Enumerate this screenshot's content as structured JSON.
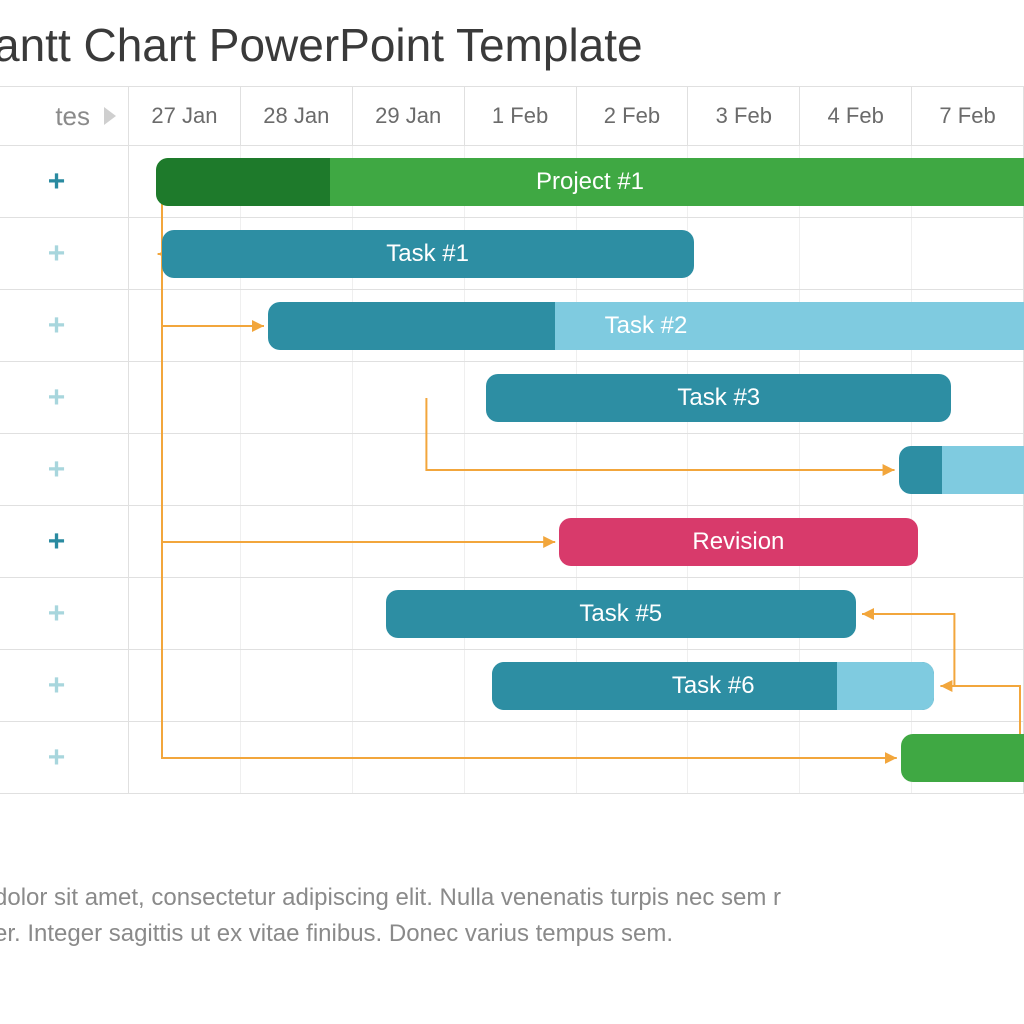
{
  "title": "antt Chart PowerPoint Template",
  "left_header": "tes",
  "dates": [
    "27 Jan",
    "28 Jan",
    "29 Jan",
    "1 Feb",
    "2 Feb",
    "3 Feb",
    "4 Feb",
    "7 Feb"
  ],
  "rows": [
    {
      "plus": "active"
    },
    {
      "plus": "muted"
    },
    {
      "plus": "muted"
    },
    {
      "plus": "muted"
    },
    {
      "plus": "muted"
    },
    {
      "plus": "active"
    },
    {
      "plus": "muted"
    },
    {
      "plus": "muted"
    },
    {
      "plus": "muted"
    }
  ],
  "bars": [
    {
      "name": "Project #1",
      "row": 0,
      "start": 0.25,
      "end": 8.0,
      "color": "#3fa843",
      "prog": 0.2,
      "progColor": "#1e7a2b",
      "roundRight": false
    },
    {
      "name": "Task #1",
      "row": 1,
      "start": 0.3,
      "end": 5.05,
      "color": "#2d8ea3"
    },
    {
      "name": "Task #2",
      "row": 2,
      "start": 1.25,
      "end": 8.0,
      "color": "#7fcbe0",
      "prog": 0.38,
      "progColor": "#2d8ea3",
      "roundRight": false
    },
    {
      "name": "Task #3",
      "row": 3,
      "start": 3.2,
      "end": 7.35,
      "color": "#2d8ea3"
    },
    {
      "name": "",
      "row": 4,
      "start": 6.88,
      "end": 8.0,
      "color": "#7fcbe0",
      "prog": 0.35,
      "progColor": "#2d8ea3",
      "roundRight": false
    },
    {
      "name": "Revision",
      "row": 5,
      "start": 3.85,
      "end": 7.05,
      "color": "#d83a6b"
    },
    {
      "name": "Task #5",
      "row": 6,
      "start": 2.3,
      "end": 6.5,
      "color": "#2d8ea3"
    },
    {
      "name": "Task #6",
      "row": 7,
      "start": 3.25,
      "end": 7.2,
      "color": "#2d8ea3",
      "prog": 0.78,
      "progColor": "#2d8ea3"
    },
    {
      "name": "",
      "row": 8,
      "start": 6.9,
      "end": 8.0,
      "color": "#3fa843",
      "roundRight": false
    }
  ],
  "footer_line1": "dolor sit amet, consectetur adipiscing elit. Nulla venenatis turpis nec sem r",
  "footer_line2": "er. Integer sagittis ut ex vitae finibus. Donec varius tempus sem.",
  "chart_data": {
    "type": "gantt",
    "title": "Gantt Chart PowerPoint Template",
    "categories": [
      "27 Jan",
      "28 Jan",
      "29 Jan",
      "1 Feb",
      "2 Feb",
      "3 Feb",
      "4 Feb",
      "7 Feb"
    ],
    "tasks": [
      {
        "name": "Project #1",
        "start": "27 Jan",
        "end": "8 Feb+",
        "progress_pct": 20,
        "color": "green"
      },
      {
        "name": "Task #1",
        "start": "27 Jan",
        "end": "3 Feb",
        "color": "teal"
      },
      {
        "name": "Task #2",
        "start": "28 Jan",
        "end": "8 Feb+",
        "progress_pct": 38,
        "color": "light-teal"
      },
      {
        "name": "Task #3",
        "start": "1 Feb",
        "end": "6 Feb",
        "color": "teal"
      },
      {
        "name": "(unnamed short)",
        "start": "5 Feb",
        "end": "8 Feb+",
        "progress_pct": 35,
        "color": "light-teal"
      },
      {
        "name": "Revision",
        "start": "2 Feb",
        "end": "5 Feb",
        "color": "pink"
      },
      {
        "name": "Task #5",
        "start": "29 Jan",
        "end": "4 Feb",
        "color": "teal"
      },
      {
        "name": "Task #6",
        "start": "1 Feb",
        "end": "6 Feb",
        "progress_pct": 78,
        "color": "teal"
      },
      {
        "name": "(unnamed green)",
        "start": "5 Feb",
        "end": "8 Feb+",
        "color": "green"
      }
    ],
    "dependencies": [
      {
        "from_row": 0,
        "to_row": 1
      },
      {
        "from_row": 0,
        "to_row": 2
      },
      {
        "from_row": 3,
        "to_row": 4
      },
      {
        "from_row": 0,
        "to_row": 5
      },
      {
        "from_row": 7,
        "to_row": 6,
        "dir": "back"
      },
      {
        "from_row": 8,
        "to_row": 7,
        "dir": "back"
      },
      {
        "from_row": 0,
        "to_row": 8
      }
    ]
  }
}
